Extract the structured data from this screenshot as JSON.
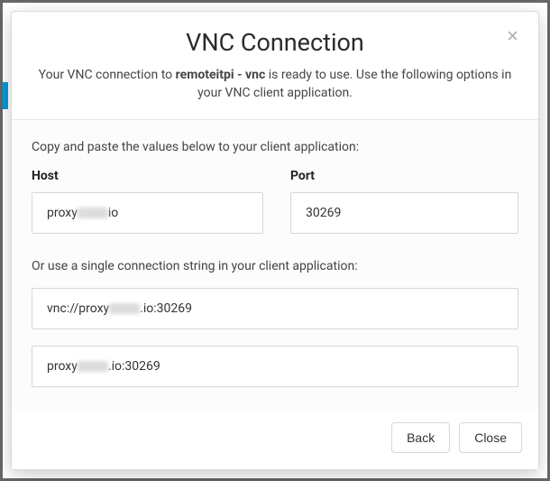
{
  "modal": {
    "title": "VNC Connection",
    "close_label": "×",
    "subtitle_prefix": "Your VNC connection to ",
    "subtitle_bold": "remoteitpi - vnc",
    "subtitle_suffix": " is ready to use. Use the following options in your VNC client application."
  },
  "body": {
    "copy_instruction": "Copy and paste the values below to your client application:",
    "host_label": "Host",
    "port_label": "Port",
    "host_prefix": "proxy",
    "host_suffix": "io",
    "port_value": "30269",
    "or_instruction": "Or use a single connection string in your client application:",
    "conn1_prefix": "vnc://proxy",
    "conn1_suffix": ".io:30269",
    "conn2_prefix": "proxy",
    "conn2_suffix": ".io:30269"
  },
  "footer": {
    "back_label": "Back",
    "close_label": "Close"
  }
}
